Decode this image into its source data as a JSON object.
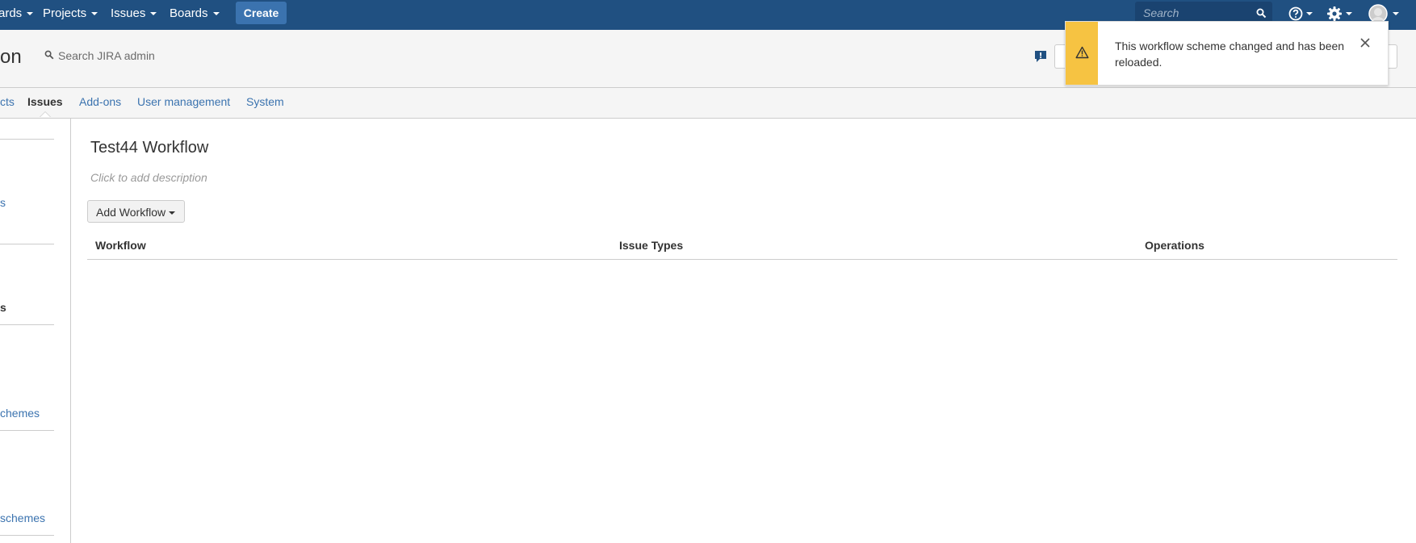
{
  "topnav": {
    "items": [
      {
        "label": "ards"
      },
      {
        "label": "Projects"
      },
      {
        "label": "Issues"
      },
      {
        "label": "Boards"
      }
    ],
    "create_label": "Create",
    "search_placeholder": "Search",
    "icons": [
      "help-icon",
      "gear-icon",
      "avatar"
    ]
  },
  "admin_header": {
    "title": "on",
    "search_placeholder": "Search JIRA admin"
  },
  "tabs": [
    {
      "label": "cts"
    },
    {
      "label": "Issues",
      "active": true
    },
    {
      "label": "Add-ons"
    },
    {
      "label": "User management"
    },
    {
      "label": "System"
    }
  ],
  "sidebar": {
    "items": [
      {
        "label": "s"
      },
      {
        "label": "s"
      },
      {
        "label": "chemes"
      },
      {
        "label": "schemes"
      }
    ]
  },
  "main": {
    "title": "Test44 Workflow",
    "description": "Click to add description",
    "add_workflow_label": "Add Workflow",
    "table": {
      "columns": [
        "Workflow",
        "Issue Types",
        "Operations"
      ]
    }
  },
  "flag": {
    "message": "This workflow scheme changed and has been reloaded.",
    "type": "warning"
  },
  "colors": {
    "nav_bg": "#205081",
    "link": "#3b73af",
    "warning": "#f6c342"
  }
}
